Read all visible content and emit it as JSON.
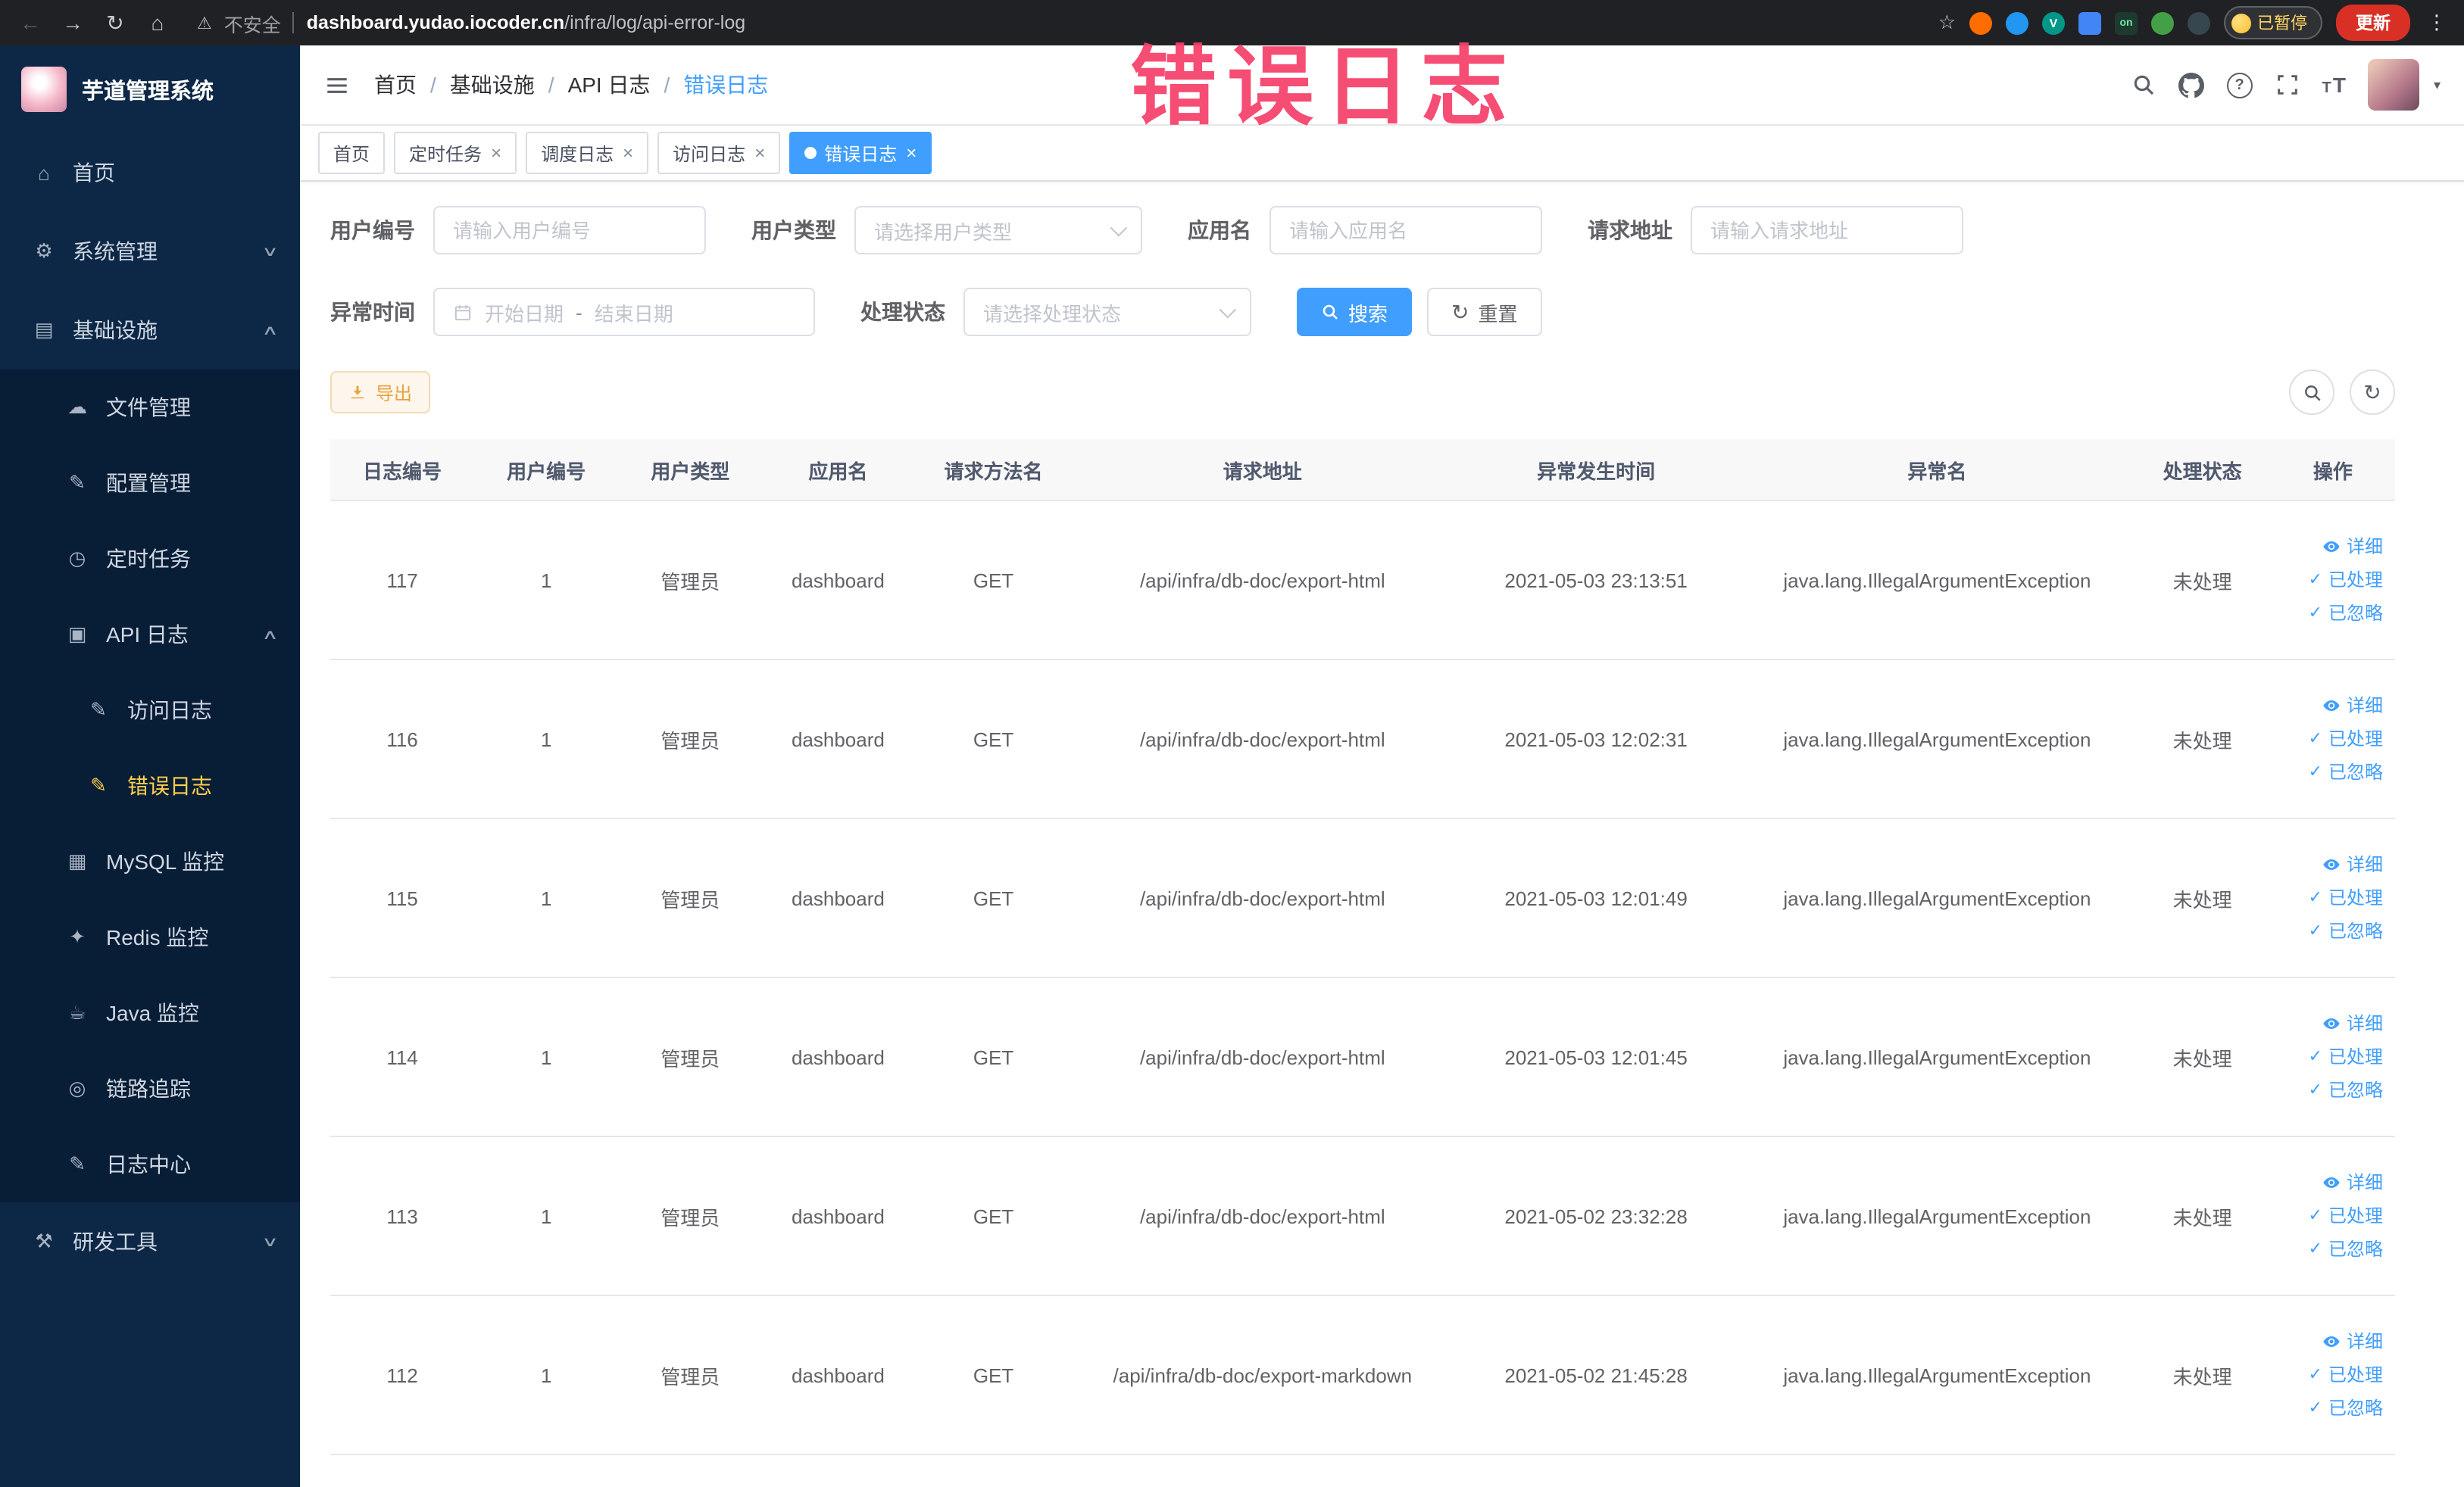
{
  "browser": {
    "security_label": "不安全",
    "url_domain": "dashboard.yudao.iocoder.cn",
    "url_path": "/infra/log/api-error-log",
    "extension_on_label": "on",
    "paused_badge": "已暂停",
    "update_button": "更新"
  },
  "annotation_text": "错误日志",
  "colors": {
    "primary": "#409eff",
    "sidebar_bg": "#0d2846",
    "sidebar_active": "#ffd04b",
    "annotation": "#f5406a",
    "warning_button": "#e6a23c"
  },
  "icons": {
    "back": "←",
    "forward": "→",
    "reload": "↻",
    "home_nav": "⌂",
    "star": "☆",
    "warning": "⚠",
    "dots": "⋮",
    "close": "×",
    "check": "✓",
    "chevron_down": "∨",
    "chevron_up": "∧",
    "caret_down": "▾",
    "question": "?",
    "refresh": "↻",
    "font_t_small": "T",
    "font_t_large": "T",
    "menu_home": "⌂",
    "menu_system": "⚙",
    "menu_infra": "▤",
    "menu_file": "☁",
    "menu_config": "✎",
    "menu_job": "◷",
    "menu_api_log": "▣",
    "menu_access_log": "✎",
    "menu_error_log": "✎",
    "menu_mysql": "▦",
    "menu_redis": "✦",
    "menu_java": "☕",
    "menu_trace": "◎",
    "menu_log_center": "✎",
    "menu_devtools": "⚒"
  },
  "sidebar": {
    "logo_title": "芋道管理系统",
    "items": [
      {
        "label": "首页"
      },
      {
        "label": "系统管理"
      },
      {
        "label": "基础设施"
      },
      {
        "label": "文件管理"
      },
      {
        "label": "配置管理"
      },
      {
        "label": "定时任务"
      },
      {
        "label": "API 日志"
      },
      {
        "label": "访问日志"
      },
      {
        "label": "错误日志"
      },
      {
        "label": "MySQL 监控"
      },
      {
        "label": "Redis 监控"
      },
      {
        "label": "Java 监控"
      },
      {
        "label": "链路追踪"
      },
      {
        "label": "日志中心"
      },
      {
        "label": "研发工具"
      }
    ]
  },
  "breadcrumb": {
    "separator": "/",
    "items": [
      {
        "label": "首页"
      },
      {
        "label": "基础设施"
      },
      {
        "label": "API 日志"
      },
      {
        "label": "错误日志"
      }
    ]
  },
  "tabs": [
    {
      "label": "首页"
    },
    {
      "label": "定时任务"
    },
    {
      "label": "调度日志"
    },
    {
      "label": "访问日志"
    },
    {
      "label": "错误日志"
    }
  ],
  "filters": {
    "user_id": {
      "label": "用户编号",
      "placeholder": "请输入用户编号",
      "value": ""
    },
    "user_type": {
      "label": "用户类型",
      "placeholder": "请选择用户类型"
    },
    "app_name": {
      "label": "应用名",
      "placeholder": "请输入应用名",
      "value": ""
    },
    "request_url": {
      "label": "请求地址",
      "placeholder": "请输入请求地址",
      "value": ""
    },
    "exception_time": {
      "label": "异常时间",
      "start_placeholder": "开始日期",
      "separator": "-",
      "end_placeholder": "结束日期"
    },
    "process_status": {
      "label": "处理状态",
      "placeholder": "请选择处理状态"
    },
    "search_button": "搜索",
    "reset_button": "重置"
  },
  "toolbar": {
    "export_button": "导出"
  },
  "table": {
    "columns": [
      "日志编号",
      "用户编号",
      "用户类型",
      "应用名",
      "请求方法名",
      "请求地址",
      "异常发生时间",
      "异常名",
      "处理状态",
      "操作"
    ],
    "actions": {
      "detail": "详细",
      "processed": "已处理",
      "ignored": "已忽略"
    },
    "rows": [
      {
        "id": "117",
        "user_id": "1",
        "user_type": "管理员",
        "app": "dashboard",
        "method": "GET",
        "url": "/api/infra/db-doc/export-html",
        "time": "2021-05-03 23:13:51",
        "exception": "java.lang.IllegalArgumentException",
        "status": "未处理"
      },
      {
        "id": "116",
        "user_id": "1",
        "user_type": "管理员",
        "app": "dashboard",
        "method": "GET",
        "url": "/api/infra/db-doc/export-html",
        "time": "2021-05-03 12:02:31",
        "exception": "java.lang.IllegalArgumentException",
        "status": "未处理"
      },
      {
        "id": "115",
        "user_id": "1",
        "user_type": "管理员",
        "app": "dashboard",
        "method": "GET",
        "url": "/api/infra/db-doc/export-html",
        "time": "2021-05-03 12:01:49",
        "exception": "java.lang.IllegalArgumentException",
        "status": "未处理"
      },
      {
        "id": "114",
        "user_id": "1",
        "user_type": "管理员",
        "app": "dashboard",
        "method": "GET",
        "url": "/api/infra/db-doc/export-html",
        "time": "2021-05-03 12:01:45",
        "exception": "java.lang.IllegalArgumentException",
        "status": "未处理"
      },
      {
        "id": "113",
        "user_id": "1",
        "user_type": "管理员",
        "app": "dashboard",
        "method": "GET",
        "url": "/api/infra/db-doc/export-html",
        "time": "2021-05-02 23:32:28",
        "exception": "java.lang.IllegalArgumentException",
        "status": "未处理"
      },
      {
        "id": "112",
        "user_id": "1",
        "user_type": "管理员",
        "app": "dashboard",
        "method": "GET",
        "url": "/api/infra/db-doc/export-markdown",
        "time": "2021-05-02 21:45:28",
        "exception": "java.lang.IllegalArgumentException",
        "status": "未处理"
      }
    ]
  }
}
